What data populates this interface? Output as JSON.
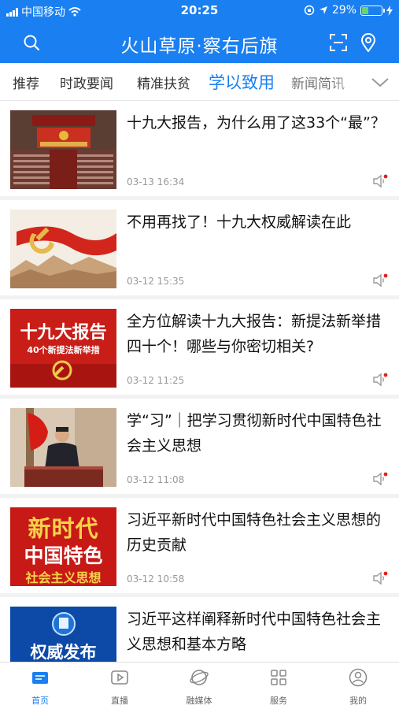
{
  "status": {
    "carrier": "中国移动",
    "time": "20:25",
    "battery": "29%"
  },
  "header": {
    "title": "火山草原·察右后旗",
    "search_icon": "search-icon",
    "scan_icon": "scan-icon",
    "location_icon": "location-pin-icon"
  },
  "tabs": [
    {
      "label": "推荐"
    },
    {
      "label": "时政要闻"
    },
    {
      "label": "精准扶贫"
    },
    {
      "label": "学以致用",
      "active": true
    },
    {
      "label": "新闻简讯"
    }
  ],
  "news": [
    {
      "title": "十九大报告，为什么用了这33个“最”？",
      "date": "03-13 16:34"
    },
    {
      "title": "不用再找了！十九大权威解读在此",
      "date": "03-12 15:35"
    },
    {
      "title": "全方位解读十九大报告：新提法新举措四十个！哪些与你密切相关?",
      "date": "03-12 11:25",
      "thumb_text": [
        "十九大报告",
        "40个新提法新举措"
      ]
    },
    {
      "title": "学“习”｜把学习贯彻新时代中国特色社会主义思想",
      "date": "03-12 11:08"
    },
    {
      "title": "习近平新时代中国特色社会主义思想的历史贡献",
      "date": "03-12 10:58",
      "thumb_text": [
        "新时代",
        "中国特色",
        "社会主义思想"
      ]
    },
    {
      "title": "习近平这样阐释新时代中国特色社会主义思想和基本方略",
      "date": "",
      "thumb_text": [
        "权威发布"
      ]
    }
  ],
  "bottom_nav": [
    {
      "label": "首页",
      "icon": "home-icon",
      "active": true
    },
    {
      "label": "直播",
      "icon": "play-icon"
    },
    {
      "label": "融媒体",
      "icon": "globe-icon"
    },
    {
      "label": "服务",
      "icon": "grid-icon"
    },
    {
      "label": "我的",
      "icon": "user-icon"
    }
  ],
  "colors": {
    "primary": "#1a7ff0",
    "red": "#d0201c"
  }
}
